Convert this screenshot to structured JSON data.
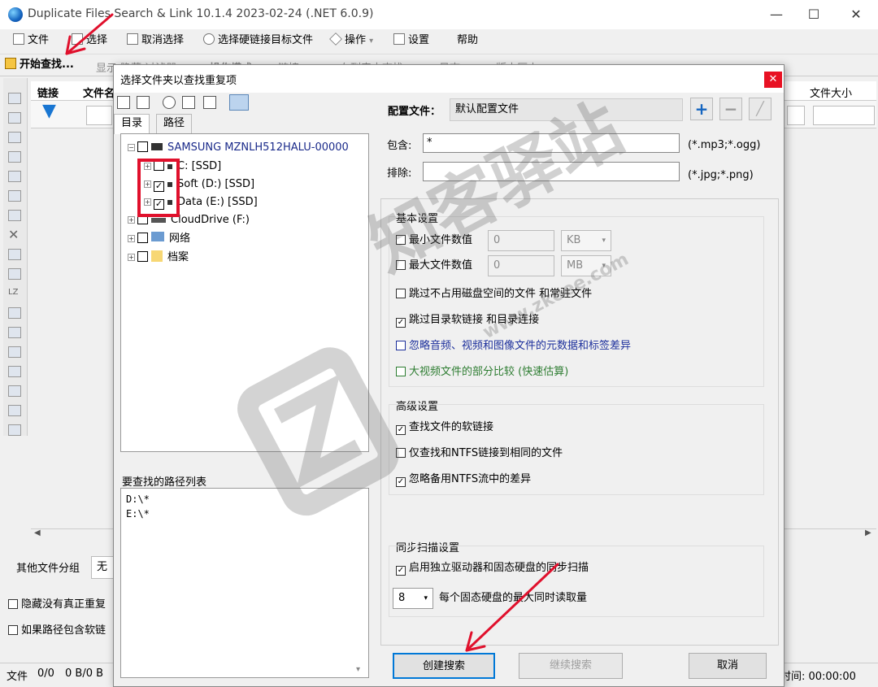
{
  "app": {
    "title": "Duplicate Files Search & Link 10.1.4 2023-02-24 (.NET 6.0.9)"
  },
  "menu": {
    "file": "文件",
    "select": "选择",
    "deselect": "取消选择",
    "select_hardlink": "选择硬链接目标文件",
    "operations": "操作",
    "settings": "设置",
    "help": "帮助"
  },
  "toolbar": {
    "start": "开始查找...",
    "ghost_items": [
      "显示 隐藏 过滤器",
      "操作模式",
      "链接",
      "在列表中查找",
      "日志",
      "版本历史"
    ]
  },
  "grid": {
    "columns": [
      "链接",
      "文件名",
      "文件大小"
    ]
  },
  "main_bottom": {
    "other_group_label": "其他文件分组",
    "other_group_value": "无",
    "hide_option": "隐藏没有真正重复",
    "softlink_option": "如果路径包含软链"
  },
  "status": {
    "left_label": "文件",
    "count": "0/0",
    "bytes": "0 B/0 B",
    "time": "时间: 00:00:00"
  },
  "dialog": {
    "title": "选择文件夹以查找重复项",
    "tabs": [
      "目录",
      "路径"
    ],
    "tree": [
      {
        "label": "SAMSUNG MZNLH512HALU-00000",
        "level": 0,
        "checked": false,
        "icon": "disk-icon",
        "color": "#1a2a8a"
      },
      {
        "label": "C: [SSD]",
        "level": 1,
        "checked": false,
        "icon": "drive-icon"
      },
      {
        "label": "Soft (D:) [SSD]",
        "level": 1,
        "checked": true,
        "icon": "drive-icon"
      },
      {
        "label": "Data (E:) [SSD]",
        "level": 1,
        "checked": true,
        "icon": "drive-icon"
      },
      {
        "label": "CloudDrive (F:)",
        "level": 0,
        "checked": false,
        "icon": "drive-icon"
      },
      {
        "label": "网络",
        "level": 0,
        "checked": false,
        "icon": "network-icon"
      },
      {
        "label": "档案",
        "level": 0,
        "checked": false,
        "icon": "folder-icon"
      }
    ],
    "path_list_label": "要查找的路径列表",
    "path_list": [
      "D:\\*",
      "E:\\*"
    ],
    "profile_label": "配置文件：",
    "profile_value": "默认配置文件",
    "include_label": "包含:",
    "include_value": "*",
    "include_hint": "(*.mp3;*.ogg)",
    "exclude_label": "排除:",
    "exclude_value": "",
    "exclude_hint": "(*.jpg;*.png)",
    "basic": {
      "title": "基本设置",
      "min_size_label": "最小文件数值",
      "min_size_value": "0",
      "min_unit": "KB",
      "max_size_label": "最大文件数值",
      "max_size_value": "0",
      "max_unit": "MB",
      "skip_files": "跳过不占用磁盘空间的文件 和常驻文件",
      "skip_links": "跳过目录软链接 和目录连接",
      "ignore_meta": "忽略音频、视频和图像文件的元数据和标签差异",
      "partial_compare": "大视频文件的部分比较 (快速估算)"
    },
    "advanced": {
      "title": "高级设置",
      "find_softlinks": "查找文件的软链接",
      "ntfs_same": "仅查找和NTFS链接到相同的文件",
      "ignore_ntfs_streams": "忽略备用NTFS流中的差异"
    },
    "sync": {
      "title": "同步扫描设置",
      "enable": "启用独立驱动器和固态硬盘的同步扫描",
      "threads_value": "8",
      "threads_label": "每个固态硬盘的最大同时读取量"
    },
    "buttons": {
      "create": "创建搜索",
      "continue": "继续搜索",
      "cancel": "取消"
    }
  },
  "watermark": {
    "text": "知客驿站",
    "url": "www.zkoee.com"
  },
  "colors": {
    "accent": "#0078d7",
    "highlight_red": "#e0102c",
    "blue_option": "#1c2f9c",
    "green_option": "#2e7d32"
  }
}
